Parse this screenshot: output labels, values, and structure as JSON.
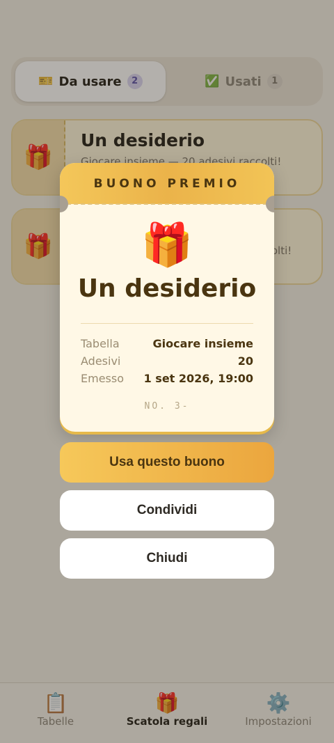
{
  "segmented": {
    "tabs": [
      {
        "icon": "🎫",
        "label": "Da usare",
        "count": "2"
      },
      {
        "icon": "✅",
        "label": "Usati",
        "count": "1"
      }
    ]
  },
  "coupons": [
    {
      "icon": "🎁",
      "title": "Un desiderio",
      "subtitle": "Giocare insieme — 20 adesivi raccolti!"
    },
    {
      "icon": "🎁",
      "title": "",
      "subtitle": "raccolti!"
    }
  ],
  "ticket": {
    "header": "BUONO PREMIO",
    "icon": "🎁",
    "title": "Un desiderio",
    "rows": [
      {
        "label": "Tabella",
        "value": "Giocare insieme"
      },
      {
        "label": "Adesivi",
        "value": "20"
      },
      {
        "label": "Emesso",
        "value": "1 set 2026, 19:00"
      }
    ],
    "number": "NO. 3-"
  },
  "actions": {
    "use": "Usa questo buono",
    "share": "Condividi",
    "close": "Chiudi"
  },
  "tabbar": {
    "items": [
      {
        "icon": "📋",
        "label": "Tabelle"
      },
      {
        "icon": "🎁",
        "label": "Scatola regali"
      },
      {
        "icon": "⚙️",
        "label": "Impostazioni"
      }
    ]
  }
}
